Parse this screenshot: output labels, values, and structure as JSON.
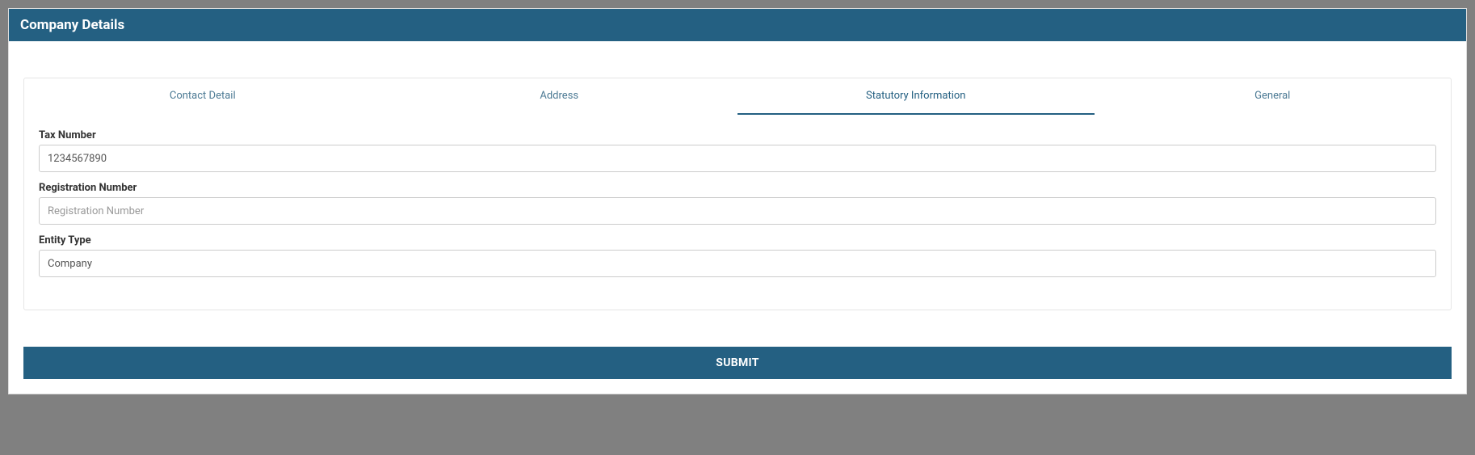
{
  "header": {
    "title": "Company Details"
  },
  "tabs": {
    "contact": "Contact Detail",
    "address": "Address",
    "statutory": "Statutory Information",
    "general": "General"
  },
  "form": {
    "tax_number": {
      "label": "Tax Number",
      "value": "1234567890"
    },
    "registration_number": {
      "label": "Registration Number",
      "placeholder": "Registration Number",
      "value": ""
    },
    "entity_type": {
      "label": "Entity Type",
      "value": "Company"
    }
  },
  "buttons": {
    "submit": "SUBMIT"
  }
}
